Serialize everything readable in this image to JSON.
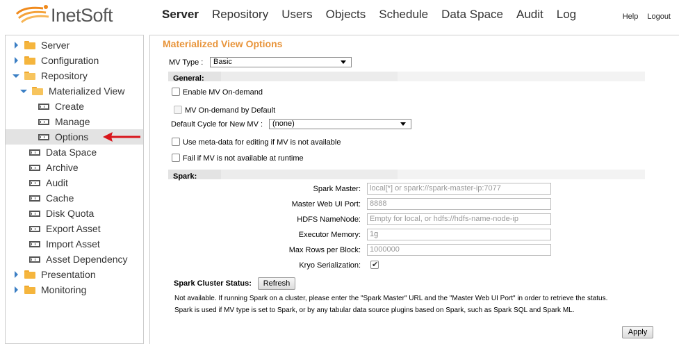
{
  "header": {
    "logo_text": "InetSoft",
    "nav": [
      "Server",
      "Repository",
      "Users",
      "Objects",
      "Schedule",
      "Data Space",
      "Audit",
      "Log"
    ],
    "active_nav": "Server",
    "help": "Help",
    "logout": "Logout"
  },
  "sidebar": {
    "items": [
      {
        "label": "Server",
        "icon": "folder-icon",
        "expanded": false
      },
      {
        "label": "Configuration",
        "icon": "folder-icon",
        "expanded": false
      },
      {
        "label": "Repository",
        "icon": "folder-open-icon",
        "expanded": true
      },
      {
        "label": "Materialized View",
        "icon": "folder-open-icon",
        "expanded": true
      },
      {
        "label": "Create",
        "icon": "mv-icon"
      },
      {
        "label": "Manage",
        "icon": "mv-icon"
      },
      {
        "label": "Options",
        "icon": "mv-icon",
        "selected": true
      },
      {
        "label": "Data Space",
        "icon": "mv-icon"
      },
      {
        "label": "Archive",
        "icon": "mv-icon"
      },
      {
        "label": "Audit",
        "icon": "mv-icon"
      },
      {
        "label": "Cache",
        "icon": "mv-icon"
      },
      {
        "label": "Disk Quota",
        "icon": "mv-icon"
      },
      {
        "label": "Export Asset",
        "icon": "mv-icon"
      },
      {
        "label": "Import Asset",
        "icon": "mv-icon"
      },
      {
        "label": "Asset Dependency",
        "icon": "mv-icon"
      },
      {
        "label": "Presentation",
        "icon": "folder-icon",
        "expanded": false
      },
      {
        "label": "Monitoring",
        "icon": "folder-icon",
        "expanded": false
      }
    ]
  },
  "main": {
    "title": "Materialized View Options",
    "mv_type_label": "MV Type :",
    "mv_type_value": "Basic",
    "general_header": "General:",
    "enable_on_demand": "Enable MV On-demand",
    "on_demand_default": "MV On-demand by Default",
    "default_cycle_label": "Default Cycle for New MV :",
    "default_cycle_value": "(none)",
    "use_metadata": "Use meta-data for editing if MV is not available",
    "fail_if_unavailable": "Fail if MV is not available at runtime",
    "spark_header": "Spark:",
    "spark_master_label": "Spark Master:",
    "spark_master_placeholder": "local[*] or spark://spark-master-ip:7077",
    "web_ui_port_label": "Master Web UI Port:",
    "web_ui_port_placeholder": "8888",
    "hdfs_label": "HDFS NameNode:",
    "hdfs_placeholder": "Empty for local, or hdfs://hdfs-name-node-ip",
    "executor_memory_label": "Executor Memory:",
    "executor_memory_value": "1g",
    "max_rows_label": "Max Rows per Block:",
    "max_rows_placeholder": "1000000",
    "kryo_label": "Kryo Serialization:",
    "kryo_checked": true,
    "cluster_status_label": "Spark Cluster Status:",
    "refresh_label": "Refresh",
    "note_line1": "Not available. If running Spark on a cluster, please enter the \"Spark Master\" URL and the \"Master Web UI Port\" in order to retrieve the status.",
    "note_line2": "Spark is used if MV type is set to Spark, or by any tabular data source plugins based on Spark, such as Spark SQL and Spark ML.",
    "apply_label": "Apply"
  },
  "colors": {
    "accent": "#e8943a",
    "folder": "#f5b53d",
    "tree_arrow": "#3b7fc4",
    "pointer_arrow": "#d9161c"
  }
}
